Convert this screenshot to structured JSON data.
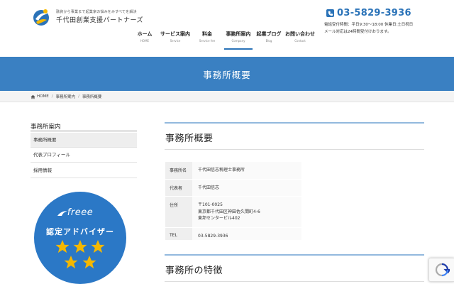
{
  "header": {
    "tagline": "融資から事業まで起業家の悩みをみすべてを解決",
    "company_name": "千代田創業支援パートナーズ",
    "phone": "03-5829-3936",
    "hours_line1": "電話受付時間：平日9:30〜18:00 休業日:土日祝日",
    "hours_line2": "メール対応は24時間受付けおります。"
  },
  "nav": [
    {
      "jp": "ホーム",
      "en": "HOME"
    },
    {
      "jp": "サービス案内",
      "en": "Service"
    },
    {
      "jp": "料金",
      "en": "Service fee"
    },
    {
      "jp": "事務所案内",
      "en": "Company"
    },
    {
      "jp": "起業ブログ",
      "en": "Blog"
    },
    {
      "jp": "お問い合わせ",
      "en": "Contact"
    }
  ],
  "page_title": "事務所概要",
  "breadcrumb": {
    "home": "HOME",
    "parent": "事務所案内",
    "current": "事務所概要"
  },
  "sidebar": {
    "title": "事務所案内",
    "items": [
      "事務所概要",
      "代表プロフィール",
      "採用情報"
    ]
  },
  "badge": {
    "brand": "freee",
    "text": "認定アドバイザー"
  },
  "main": {
    "title": "事務所概要",
    "rows": [
      {
        "label": "事務所名",
        "lines": [
          "千代田信志税理士事務所"
        ]
      },
      {
        "label": "代表者",
        "lines": [
          "千代田信志"
        ]
      },
      {
        "label": "住所",
        "lines": [
          "〒101-0025",
          "東京都千代田区神田佐久間町4-6",
          "東邦センタービル402"
        ]
      },
      {
        "label": "TEL",
        "lines": [
          "03-5829-3936"
        ]
      }
    ],
    "section_title": "事務所の特徴"
  },
  "colors": {
    "brand_blue": "#3a80c2",
    "badge_blue": "#2b78c6",
    "star_yellow": "#f5b800"
  }
}
